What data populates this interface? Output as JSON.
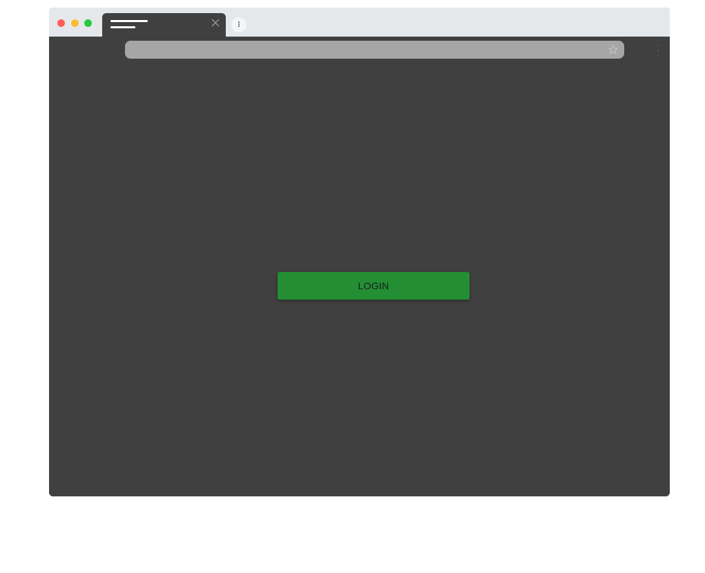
{
  "browser": {
    "traffic_lights": {
      "close_color": "#ff5f57",
      "minimize_color": "#febc2e",
      "maximize_color": "#28c840"
    },
    "tab": {
      "close_icon": "close-icon"
    },
    "new_tab_icon": "new-tab-icon",
    "address_bar": {
      "value": "",
      "bookmark_icon": "star-icon"
    },
    "menu_icon": "kebab-menu-icon"
  },
  "page": {
    "background_color": "#404040",
    "login_button": {
      "label": "LOGIN",
      "color": "#238e33"
    }
  }
}
